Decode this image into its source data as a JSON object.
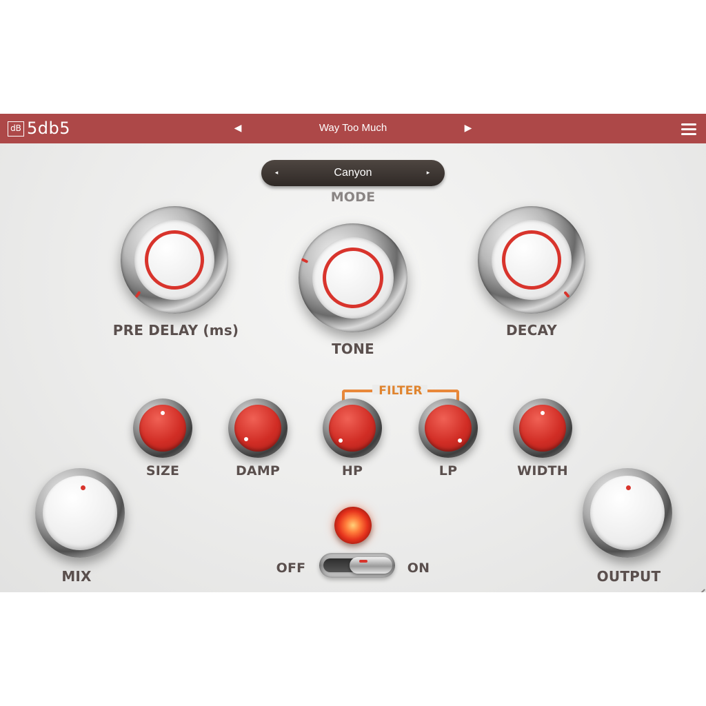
{
  "header": {
    "logo_badge": "dB",
    "plugin_name": "5db5",
    "preset_prev": "◀",
    "preset_name": "Way Too Much",
    "preset_next": "▶",
    "menu_icon": "hamburger-menu-icon"
  },
  "mode": {
    "prev": "◂",
    "value": "Canyon",
    "next": "▸",
    "label": "MODE"
  },
  "knobs": {
    "pre_delay": "PRE DELAY (ms)",
    "tone": "TONE",
    "decay": "DECAY",
    "size": "SIZE",
    "damp": "DAMP",
    "hp": "HP",
    "lp": "LP",
    "width": "WIDTH",
    "mix": "MIX",
    "output": "OUTPUT"
  },
  "filter_group_label": "FILTER",
  "power": {
    "off_label": "OFF",
    "on_label": "ON",
    "state": "on"
  },
  "colors": {
    "header_bg": "#ad4848",
    "accent_red": "#d8342c",
    "filter_orange": "#e8883a",
    "label_text": "#5a4f4d"
  }
}
